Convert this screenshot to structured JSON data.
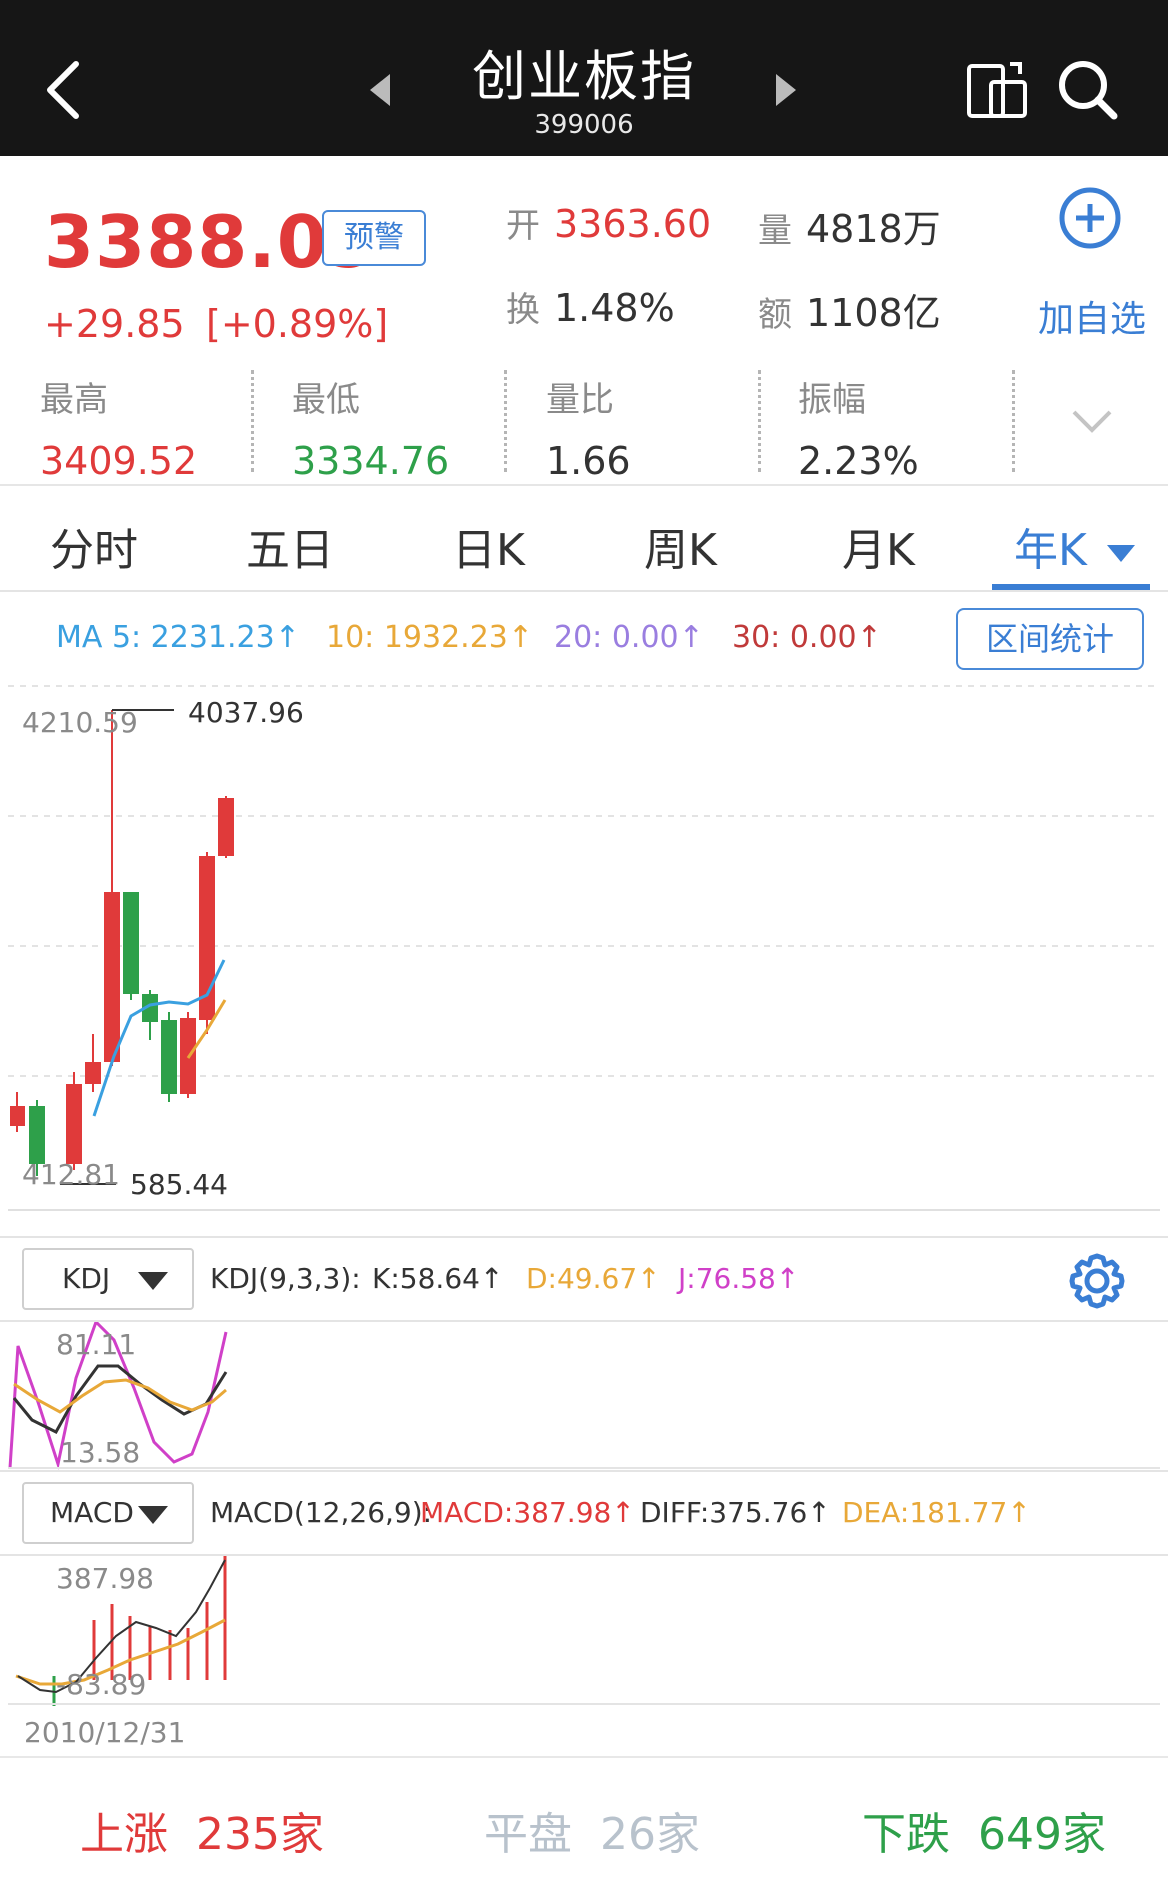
{
  "header": {
    "title": "创业板指",
    "code": "399006"
  },
  "quote": {
    "price": "3388.09",
    "alert_label": "预警",
    "change": "+29.85",
    "change_pct": "[+0.89%]",
    "open_label": "开",
    "open_value": "3363.60",
    "volume_label": "量",
    "volume_value": "4818万",
    "turnover_label": "换",
    "turnover_value": "1.48%",
    "amount_label": "额",
    "amount_value": "1108亿",
    "add_watch_label": "加自选",
    "stats": [
      {
        "label": "最高",
        "value": "3409.52"
      },
      {
        "label": "最低",
        "value": "3334.76"
      },
      {
        "label": "量比",
        "value": "1.66"
      },
      {
        "label": "振幅",
        "value": "2.23%"
      }
    ]
  },
  "tabs": [
    "分时",
    "五日",
    "日K",
    "周K",
    "月K",
    "年K"
  ],
  "ma": {
    "ma5": "MA 5: 2231.23↑",
    "ma10": "10: 1932.23↑",
    "ma20": "20: 0.00↑",
    "ma30": "30: 0.00↑",
    "range_label": "区间统计"
  },
  "chart_main": {
    "y_top": "4210.59",
    "y_bottom": "412.81",
    "high_marker": "4037.96",
    "low_marker": "585.44"
  },
  "kdj": {
    "selector": "KDJ",
    "params": "KDJ(9,3,3):",
    "k": "K:58.64↑",
    "d": "D:49.67↑",
    "j": "J:76.58↑",
    "y_top": "81.11",
    "y_bottom": "13.58"
  },
  "macd": {
    "selector": "MACD",
    "params": "MACD(12,26,9):",
    "macd": "MACD:387.98↑",
    "diff": "DIFF:375.76↑",
    "dea": "DEA:181.77↑",
    "y_top": "387.98",
    "y_bottom": "-83.89"
  },
  "date": "2010/12/31",
  "footer": {
    "up_label": "上涨",
    "up_count": "235家",
    "flat_label": "平盘",
    "flat_count": "26家",
    "down_label": "下跌",
    "down_count": "649家"
  },
  "colors": {
    "up": "#e03a3a",
    "down": "#2ea04a",
    "accent": "#3a7ed4",
    "ma5": "#3aa0e0",
    "ma10": "#e8a838",
    "ma20": "#9a7ee0",
    "ma30": "#c03a3a",
    "j_line": "#d040c8"
  }
}
